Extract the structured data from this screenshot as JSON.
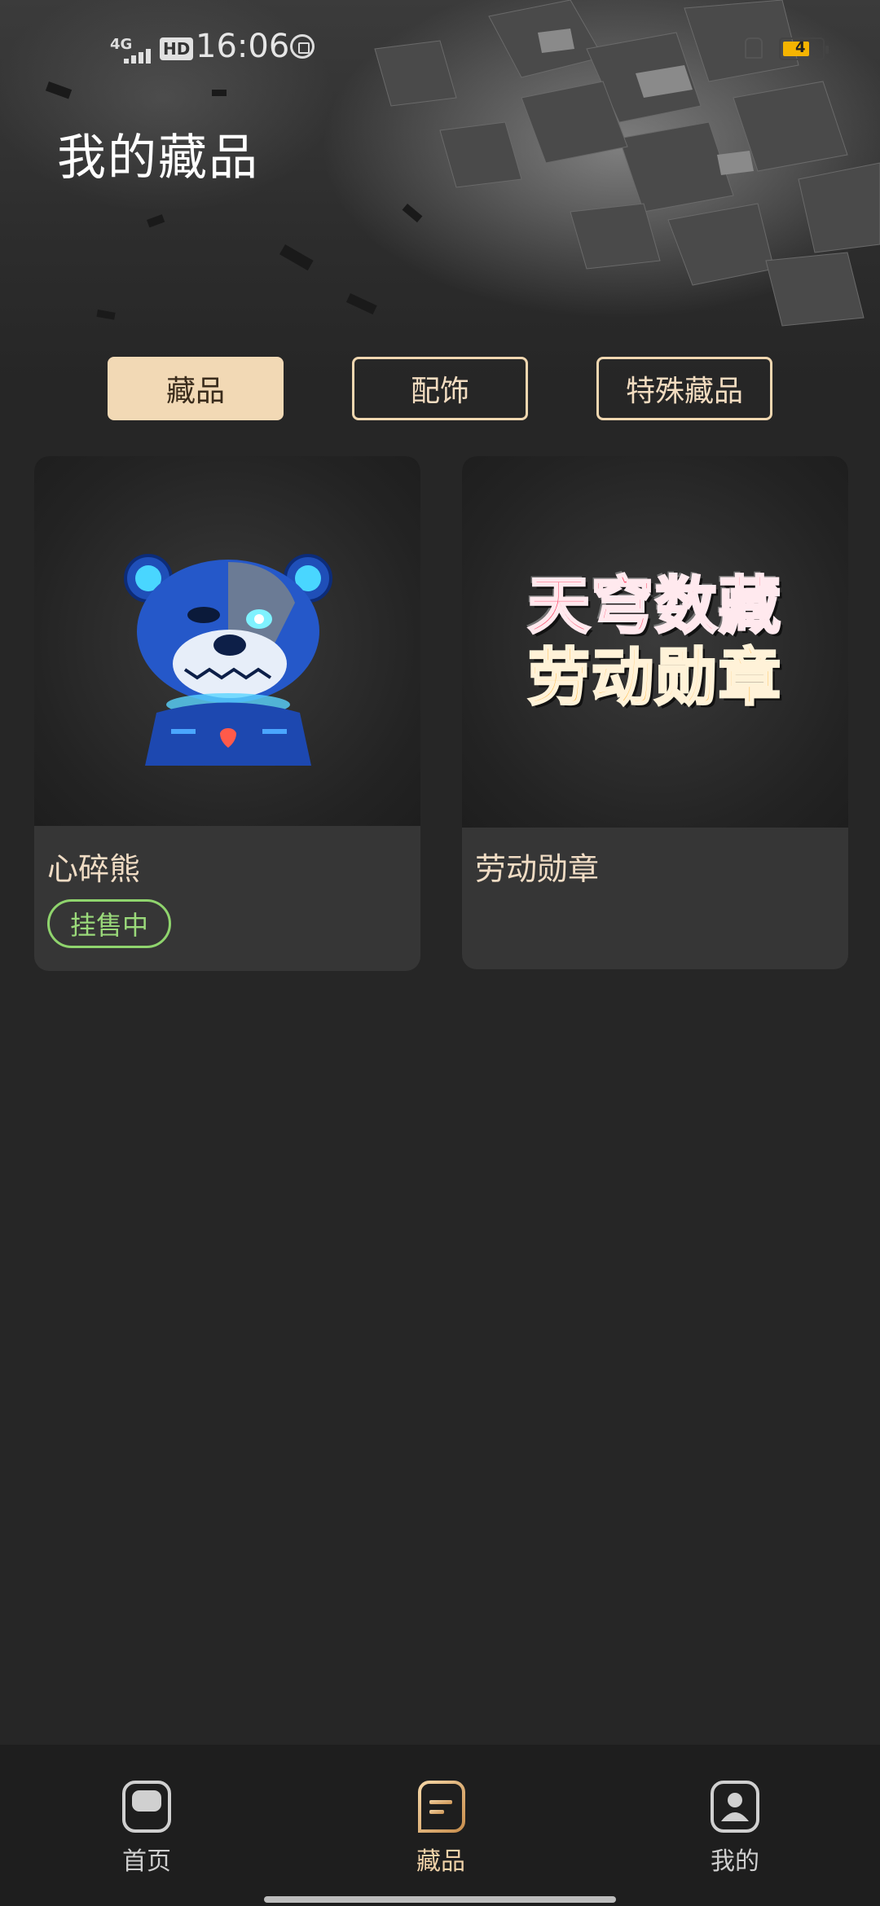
{
  "status_bar": {
    "network": "4G",
    "hd_label": "HD",
    "time": "16:06",
    "battery_level": "4"
  },
  "header": {
    "title": "我的藏品"
  },
  "tabs": [
    {
      "label": "藏品",
      "active": true
    },
    {
      "label": "配饰",
      "active": false
    },
    {
      "label": "特殊藏品",
      "active": false
    }
  ],
  "items": [
    {
      "name": "心碎熊",
      "badge": "挂售中",
      "image": "blue-robot-bear"
    },
    {
      "name": "劳动勋章",
      "badge": "",
      "image": "medal-title-art",
      "art_text_line1": "天穹数藏",
      "art_text_line2": "劳动勋章"
    }
  ],
  "bottom_nav": [
    {
      "label": "首页",
      "icon": "home-icon",
      "active": false
    },
    {
      "label": "藏品",
      "icon": "collection-icon",
      "active": true
    },
    {
      "label": "我的",
      "icon": "profile-icon",
      "active": false
    }
  ],
  "colors": {
    "background": "#262626",
    "accent": "#f2d9b5",
    "badge_green": "#8fd46d",
    "nav_active": "#f0d2a8"
  }
}
